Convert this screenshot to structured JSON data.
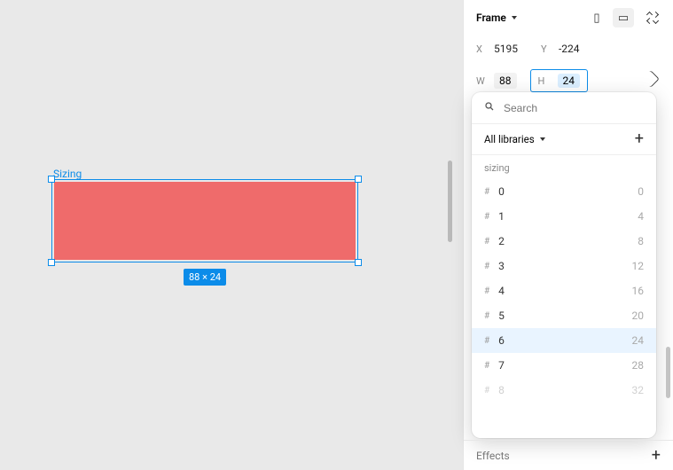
{
  "canvas": {
    "frame_label": "Sizing",
    "size_badge": "88 × 24"
  },
  "panel": {
    "frame_title": "Frame",
    "position": {
      "x_label": "X",
      "x_value": "5195",
      "y_label": "Y",
      "y_value": "-224"
    },
    "size": {
      "w_label": "W",
      "w_value": "88",
      "h_label": "H",
      "h_value": "24"
    },
    "effects_label": "Effects"
  },
  "popover": {
    "search_placeholder": "Search",
    "libraries_label": "All libraries",
    "section_label": "sizing",
    "tokens": [
      {
        "key": "0",
        "value": "0"
      },
      {
        "key": "1",
        "value": "4"
      },
      {
        "key": "2",
        "value": "8"
      },
      {
        "key": "3",
        "value": "12"
      },
      {
        "key": "4",
        "value": "16"
      },
      {
        "key": "5",
        "value": "20"
      },
      {
        "key": "6",
        "value": "24"
      },
      {
        "key": "7",
        "value": "28"
      },
      {
        "key": "8",
        "value": "32"
      }
    ],
    "selected_key": "6"
  }
}
